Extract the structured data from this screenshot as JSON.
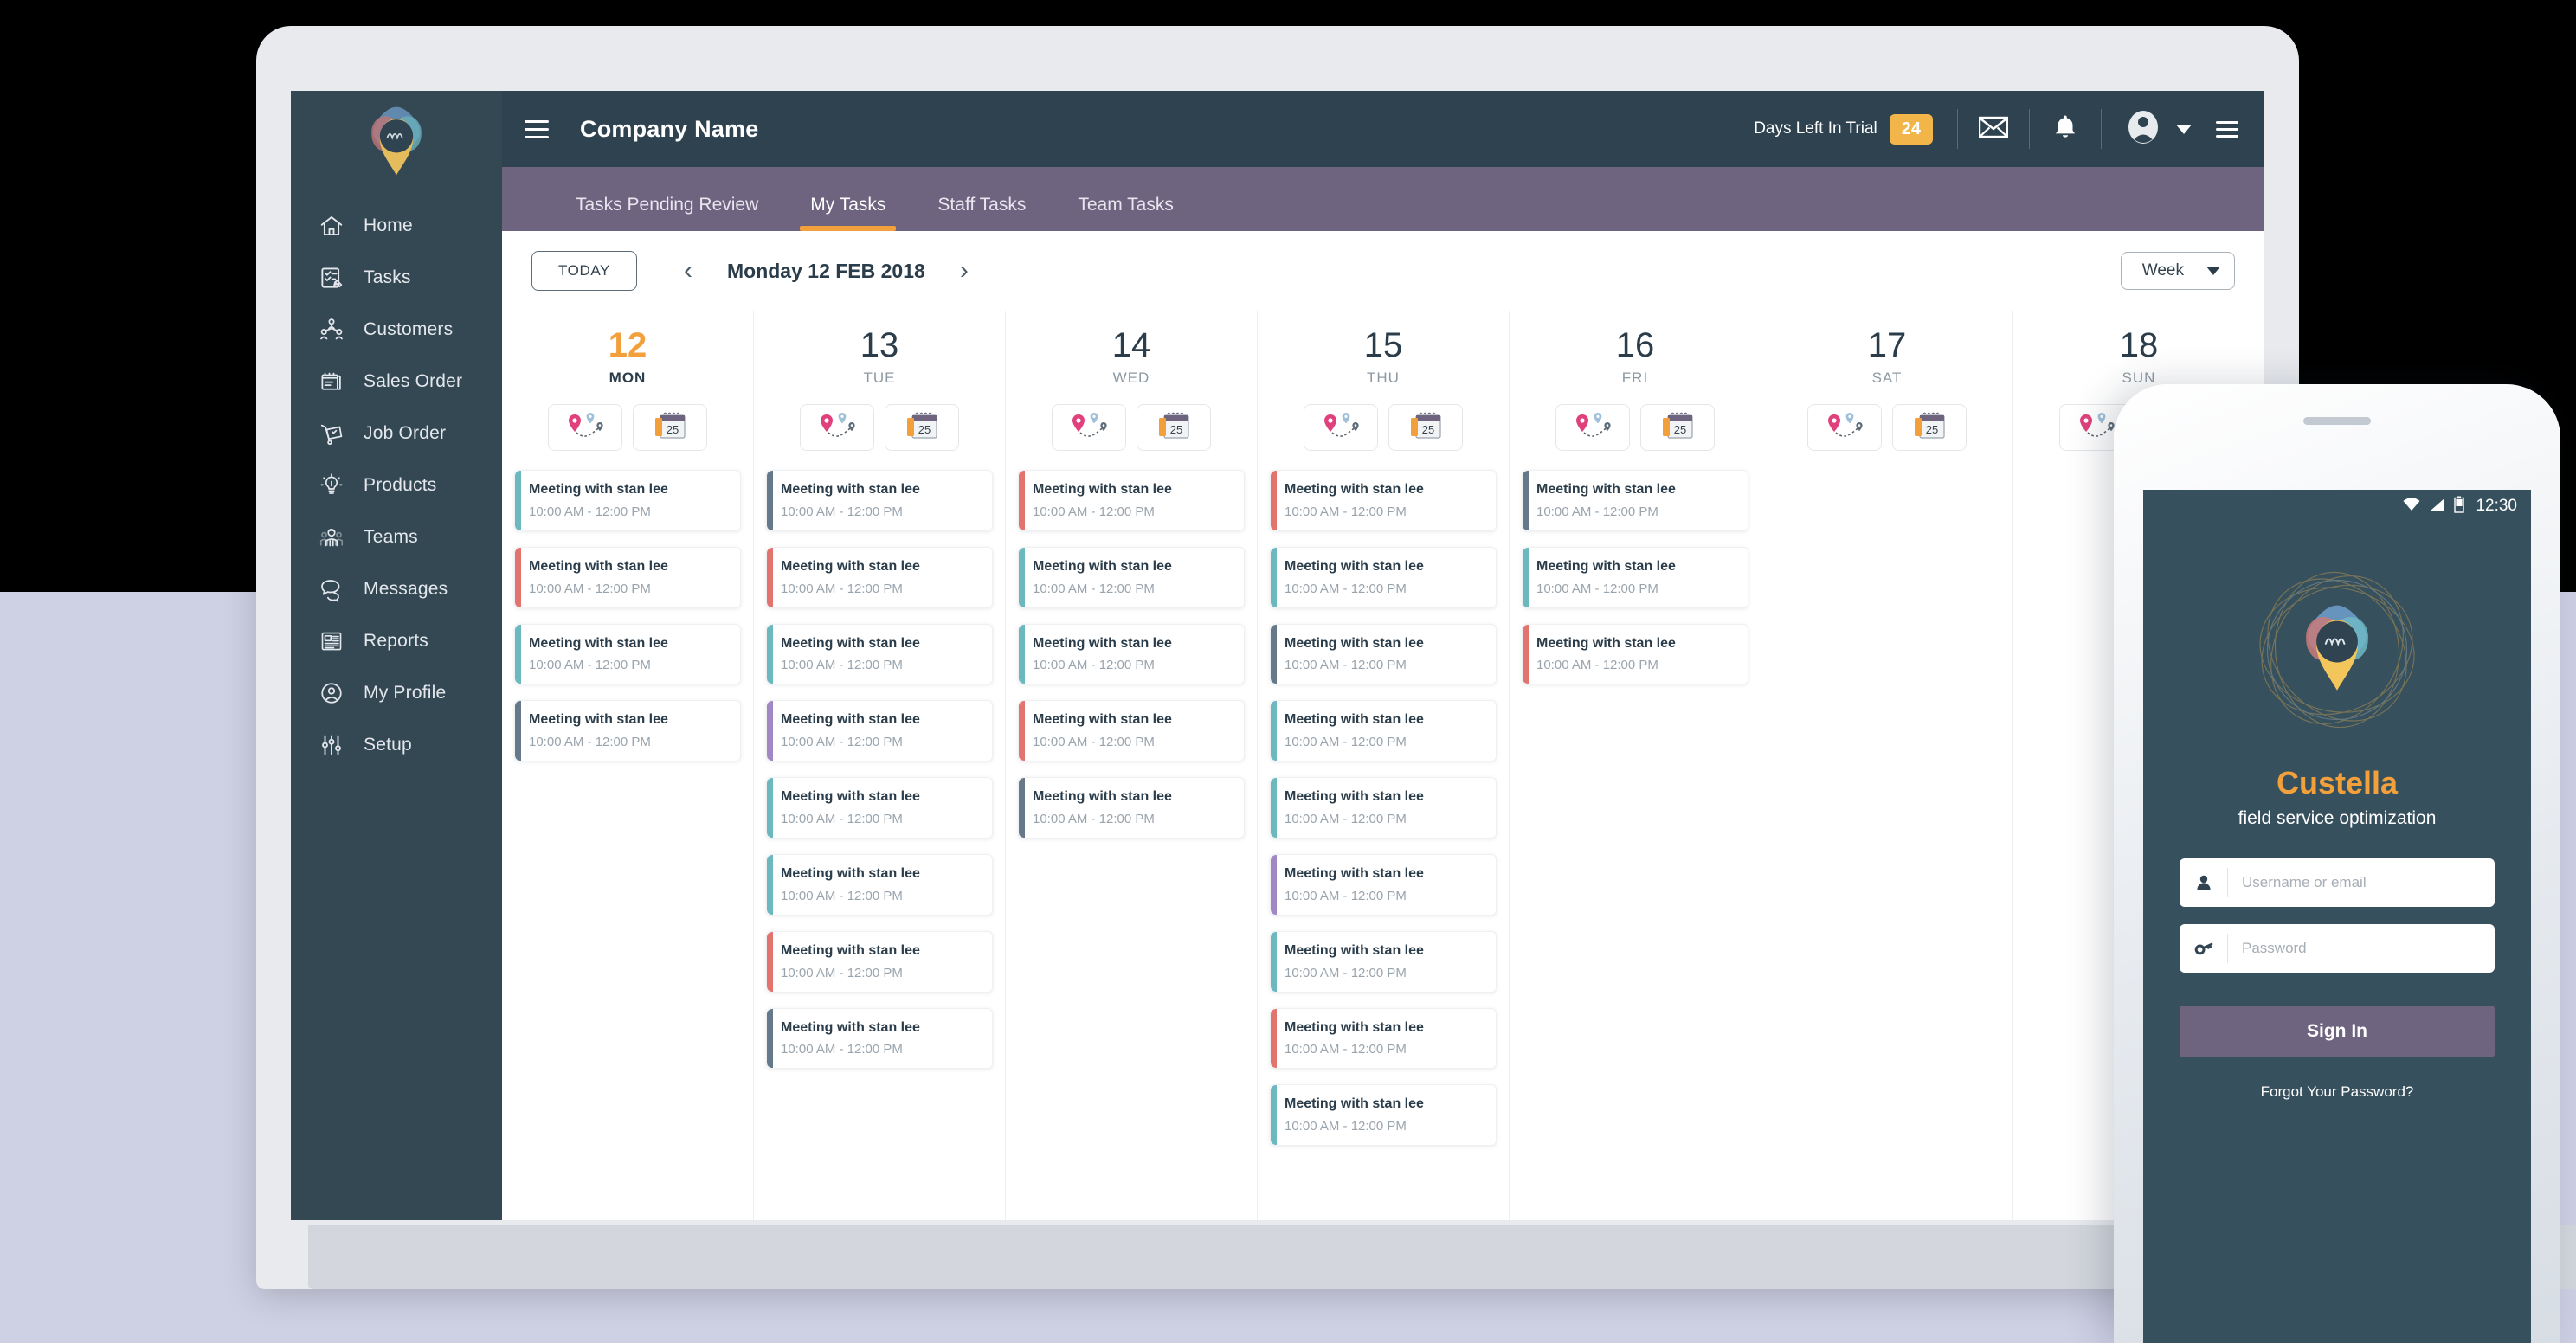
{
  "app": {
    "company_name": "Company Name",
    "logo_icon": "custella-pin-logo"
  },
  "topbar": {
    "menu_icon": "hamburger-icon",
    "trial_label": "Days Left In Trial",
    "trial_days": "24",
    "mail_icon": "envelope-icon",
    "bell_icon": "bell-icon",
    "avatar_icon": "user-avatar-icon",
    "caret_icon": "caret-down-icon",
    "right_menu_icon": "menu-icon"
  },
  "sidebar": {
    "items": [
      {
        "label": "Home",
        "icon": "home-icon"
      },
      {
        "label": "Tasks",
        "icon": "tasks-checklist-icon"
      },
      {
        "label": "Customers",
        "icon": "customers-group-icon"
      },
      {
        "label": "Sales Order",
        "icon": "sales-order-icon"
      },
      {
        "label": "Job Order",
        "icon": "job-order-icon"
      },
      {
        "label": "Products",
        "icon": "lightbulb-icon"
      },
      {
        "label": "Teams",
        "icon": "teams-icon"
      },
      {
        "label": "Messages",
        "icon": "chat-bubbles-icon"
      },
      {
        "label": "Reports",
        "icon": "newspaper-icon"
      },
      {
        "label": "My Profile",
        "icon": "profile-circle-icon"
      },
      {
        "label": "Setup",
        "icon": "sliders-icon"
      }
    ]
  },
  "tabs": [
    {
      "label": "Tasks Pending Review",
      "active": false
    },
    {
      "label": "My Tasks",
      "active": true
    },
    {
      "label": "Staff Tasks",
      "active": false
    },
    {
      "label": "Team Tasks",
      "active": false
    }
  ],
  "toolbar": {
    "today_label": "TODAY",
    "prev_icon": "chevron-left-icon",
    "next_icon": "chevron-right-icon",
    "current_date": "Monday  12  FEB 2018",
    "view_label": "Week",
    "view_caret_icon": "caret-down-icon"
  },
  "calendar": {
    "map_icon": "route-map-pin-icon",
    "calendar_icon": "calendar-25-icon",
    "task_title": "Meeting with stan lee",
    "task_time": "10:00 AM  -  12:00 PM",
    "colors": {
      "teal": "#6cb8bf",
      "red": "#e2736f",
      "slate": "#66798a",
      "purple": "#a188c4",
      "accent_orange": "#f2a03c"
    },
    "days": [
      {
        "num": "12",
        "name": "MON",
        "today": true,
        "tasks": [
          {
            "title": "Meeting with stan lee",
            "time": "10:00 AM  -  12:00 PM",
            "color": "teal"
          },
          {
            "title": "Meeting with stan lee",
            "time": "10:00 AM  -  12:00 PM",
            "color": "red"
          },
          {
            "title": "Meeting with stan lee",
            "time": "10:00 AM  -  12:00 PM",
            "color": "teal"
          },
          {
            "title": "Meeting with stan lee",
            "time": "10:00 AM  -  12:00 PM",
            "color": "slate"
          }
        ]
      },
      {
        "num": "13",
        "name": "TUE",
        "today": false,
        "tasks": [
          {
            "title": "Meeting with stan lee",
            "time": "10:00 AM  -  12:00 PM",
            "color": "slate"
          },
          {
            "title": "Meeting with stan lee",
            "time": "10:00 AM  -  12:00 PM",
            "color": "red"
          },
          {
            "title": "Meeting with stan lee",
            "time": "10:00 AM  -  12:00 PM",
            "color": "teal"
          },
          {
            "title": "Meeting with stan lee",
            "time": "10:00 AM  -  12:00 PM",
            "color": "purple"
          },
          {
            "title": "Meeting with stan lee",
            "time": "10:00 AM  -  12:00 PM",
            "color": "teal"
          },
          {
            "title": "Meeting with stan lee",
            "time": "10:00 AM  -  12:00 PM",
            "color": "teal"
          },
          {
            "title": "Meeting with stan lee",
            "time": "10:00 AM  -  12:00 PM",
            "color": "red"
          },
          {
            "title": "Meeting with stan lee",
            "time": "10:00 AM  -  12:00 PM",
            "color": "slate"
          }
        ]
      },
      {
        "num": "14",
        "name": "WED",
        "today": false,
        "tasks": [
          {
            "title": "Meeting with stan lee",
            "time": "10:00 AM  -  12:00 PM",
            "color": "red"
          },
          {
            "title": "Meeting with stan lee",
            "time": "10:00 AM  -  12:00 PM",
            "color": "teal"
          },
          {
            "title": "Meeting with stan lee",
            "time": "10:00 AM  -  12:00 PM",
            "color": "teal"
          },
          {
            "title": "Meeting with stan lee",
            "time": "10:00 AM  -  12:00 PM",
            "color": "red"
          },
          {
            "title": "Meeting with stan lee",
            "time": "10:00 AM  -  12:00 PM",
            "color": "slate"
          }
        ]
      },
      {
        "num": "15",
        "name": "THU",
        "today": false,
        "tasks": [
          {
            "title": "Meeting with stan lee",
            "time": "10:00 AM  -  12:00 PM",
            "color": "red"
          },
          {
            "title": "Meeting with stan lee",
            "time": "10:00 AM  -  12:00 PM",
            "color": "teal"
          },
          {
            "title": "Meeting with stan lee",
            "time": "10:00 AM  -  12:00 PM",
            "color": "slate"
          },
          {
            "title": "Meeting with stan lee",
            "time": "10:00 AM  -  12:00 PM",
            "color": "teal"
          },
          {
            "title": "Meeting with stan lee",
            "time": "10:00 AM  -  12:00 PM",
            "color": "teal"
          },
          {
            "title": "Meeting with stan lee",
            "time": "10:00 AM  -  12:00 PM",
            "color": "purple"
          },
          {
            "title": "Meeting with stan lee",
            "time": "10:00 AM  -  12:00 PM",
            "color": "teal"
          },
          {
            "title": "Meeting with stan lee",
            "time": "10:00 AM  -  12:00 PM",
            "color": "red"
          },
          {
            "title": "Meeting with stan lee",
            "time": "10:00 AM  -  12:00 PM",
            "color": "teal"
          }
        ]
      },
      {
        "num": "16",
        "name": "FRI",
        "today": false,
        "tasks": [
          {
            "title": "Meeting with stan lee",
            "time": "10:00 AM  -  12:00 PM",
            "color": "slate"
          },
          {
            "title": "Meeting with stan lee",
            "time": "10:00 AM  -  12:00 PM",
            "color": "teal"
          },
          {
            "title": "Meeting with stan lee",
            "time": "10:00 AM  -  12:00 PM",
            "color": "red"
          }
        ]
      },
      {
        "num": "17",
        "name": "SAT",
        "today": false,
        "tasks": []
      },
      {
        "num": "18",
        "name": "SUN",
        "today": false,
        "tasks": []
      }
    ]
  },
  "phone": {
    "statusbar": {
      "wifi_icon": "wifi-icon",
      "signal_icon": "signal-bars-icon",
      "battery_icon": "battery-icon",
      "time": "12:30"
    },
    "logo_icon": "custella-pin-logo",
    "app_name": "Custella",
    "tagline": "field service optimization",
    "username_placeholder": "Username or email",
    "username_value": "",
    "username_icon": "person-icon",
    "password_placeholder": "Password",
    "password_value": "",
    "password_icon": "key-icon",
    "signin_label": "Sign In",
    "forgot_label": "Forgot Your Password?"
  }
}
